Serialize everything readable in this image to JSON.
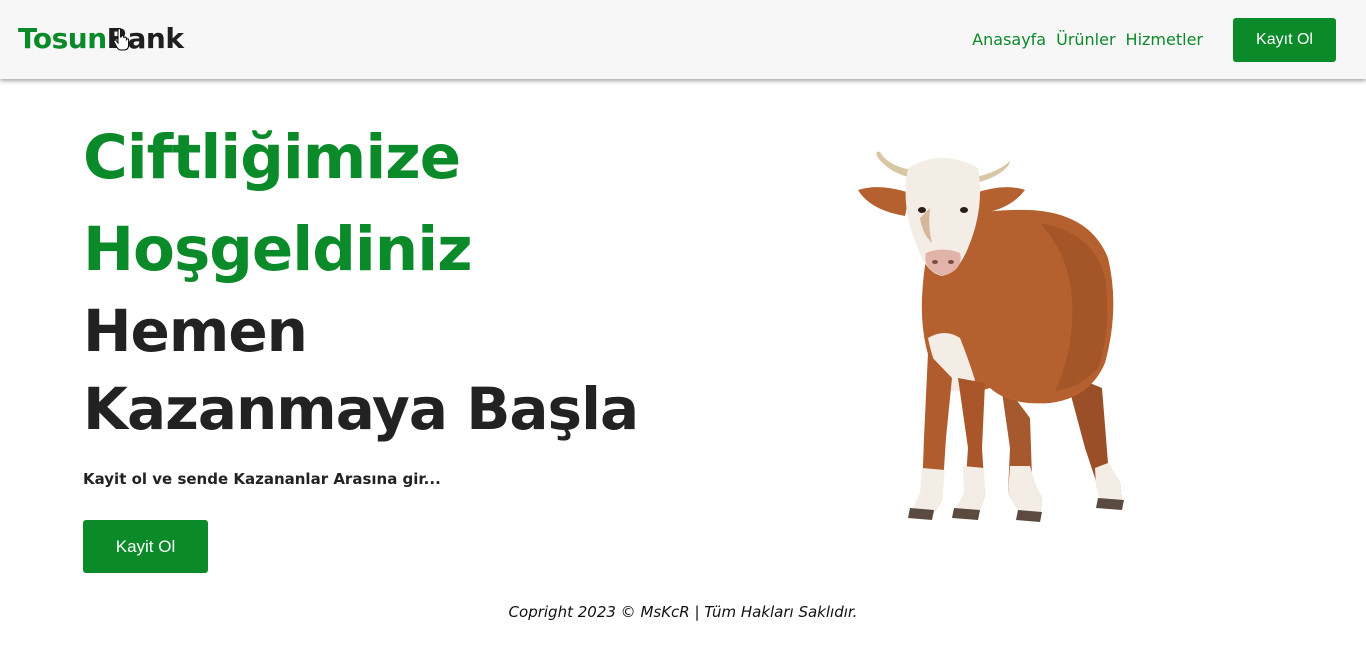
{
  "navbar": {
    "logo_part1": "Tosun",
    "logo_part2": "Bank",
    "links": [
      "Anasayfa",
      "Ürünler",
      "Hizmetler"
    ],
    "register_label": "Kayıt Ol"
  },
  "hero": {
    "title_line1": "Ciftliğimize",
    "title_line2": "Hoşgeldiniz",
    "title_line3": "Hemen",
    "title_line4": "Kazanmaya Başla",
    "subtitle": "Kayit ol ve sende Kazananlar Arasına gir...",
    "button_label": "Kayit Ol",
    "image": "cow-image"
  },
  "footer": {
    "copyright": "Copright 2023 © MsKcR | Tüm Hakları Saklıdır."
  },
  "colors": {
    "accent": "#0b8a2a",
    "dark_text": "#222222",
    "navbar_bg": "#f7f7f7"
  }
}
